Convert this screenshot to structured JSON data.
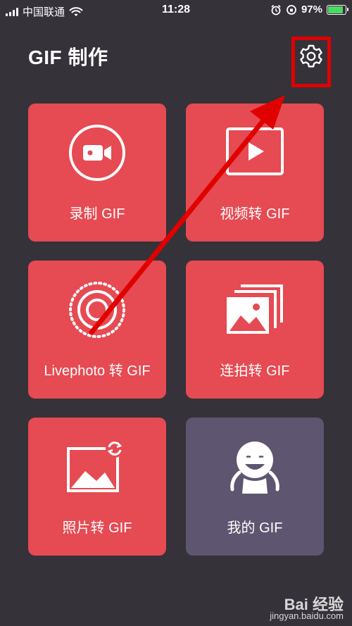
{
  "status_bar": {
    "carrier": "中国联通",
    "time": "11:28",
    "battery": "97%",
    "battery_level": 0.97
  },
  "header": {
    "title": "GIF 制作",
    "settings_icon": "gear-icon"
  },
  "tiles": [
    {
      "label": "录制 GIF",
      "icon": "record-camera-icon"
    },
    {
      "label": "视频转 GIF",
      "icon": "video-play-icon"
    },
    {
      "label": "Livephoto 转 GIF",
      "icon": "livephoto-icon"
    },
    {
      "label": "连拍转 GIF",
      "icon": "burst-photos-icon"
    },
    {
      "label": "照片转 GIF",
      "icon": "photo-convert-icon"
    },
    {
      "label": "我的 GIF",
      "icon": "my-gif-avatar-icon"
    }
  ],
  "watermark": {
    "brand": "Bai 经验",
    "url": "jingyan.baidu.com"
  },
  "colors": {
    "background": "#35323a",
    "tile_red": "#e64a52",
    "tile_purple": "#5e5570",
    "annotation_red": "#e00000"
  }
}
